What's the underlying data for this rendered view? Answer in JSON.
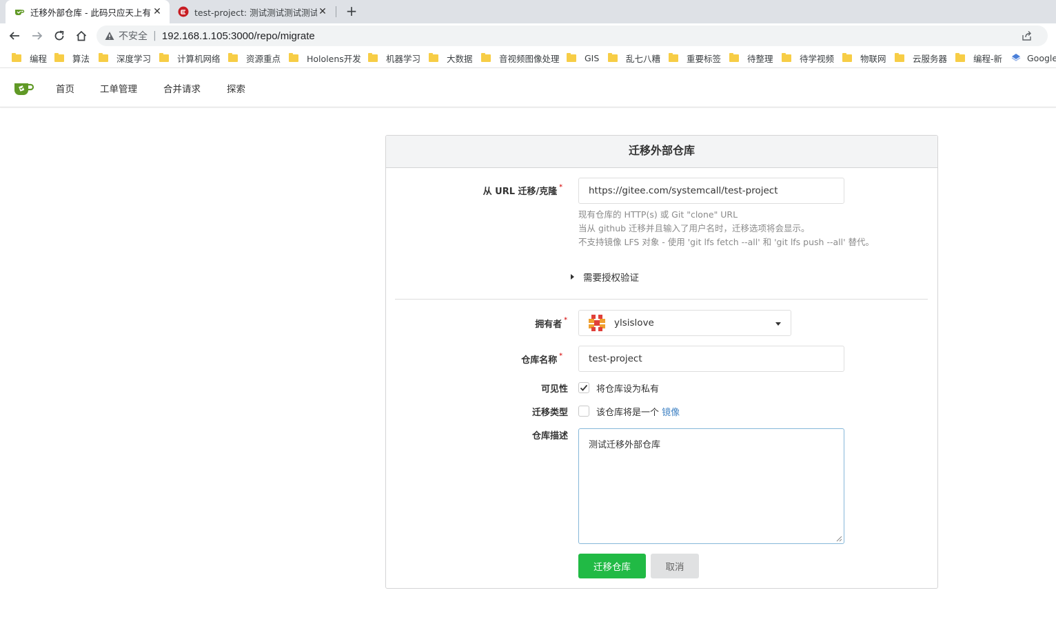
{
  "browser": {
    "tabs": [
      {
        "title": "迁移外部仓库 - 此码只应天上有",
        "active": true
      },
      {
        "title": "test-project: 测试测试测试测试",
        "active": false
      }
    ],
    "address": {
      "security_label": "不安全",
      "url": "192.168.1.105:3000/repo/migrate"
    },
    "bookmarks": [
      {
        "label": "编程",
        "icon": "folder-icon"
      },
      {
        "label": "算法",
        "icon": "folder-icon"
      },
      {
        "label": "深度学习",
        "icon": "folder-icon"
      },
      {
        "label": "计算机网络",
        "icon": "folder-icon"
      },
      {
        "label": "资源重点",
        "icon": "folder-icon"
      },
      {
        "label": "Hololens开发",
        "icon": "folder-icon"
      },
      {
        "label": "机器学习",
        "icon": "folder-icon"
      },
      {
        "label": "大数据",
        "icon": "folder-icon"
      },
      {
        "label": "音视频图像处理",
        "icon": "folder-icon"
      },
      {
        "label": "GIS",
        "icon": "folder-icon"
      },
      {
        "label": "乱七八糟",
        "icon": "folder-icon"
      },
      {
        "label": "重要标签",
        "icon": "folder-icon"
      },
      {
        "label": "待整理",
        "icon": "folder-icon"
      },
      {
        "label": "待学视频",
        "icon": "folder-icon"
      },
      {
        "label": "物联网",
        "icon": "folder-icon"
      },
      {
        "label": "云服务器",
        "icon": "folder-icon"
      },
      {
        "label": "编程-新",
        "icon": "folder-icon"
      },
      {
        "label": "Google",
        "icon": "google-icon"
      }
    ]
  },
  "nav": {
    "items": [
      "首页",
      "工单管理",
      "合并请求",
      "探索"
    ]
  },
  "form": {
    "title": "迁移外部仓库",
    "clone_url": {
      "label": "从 URL 迁移/克隆",
      "value": "https://gitee.com/systemcall/test-project"
    },
    "help_lines": [
      "现有仓库的 HTTP(s) 或 Git \"clone\" URL",
      "当从 github 迁移并且输入了用户名时，迁移选项将会显示。",
      "不支持镜像 LFS 对象 - 使用 'git lfs fetch --all' 和 'git lfs push --all' 替代。"
    ],
    "auth_toggle": "需要授权验证",
    "owner": {
      "label": "拥有者",
      "value": "ylsislove"
    },
    "repo_name": {
      "label": "仓库名称",
      "value": "test-project"
    },
    "visibility": {
      "label": "可见性",
      "checkbox_text": "将仓库设为私有",
      "checked": true
    },
    "migrate_type": {
      "label": "迁移类型",
      "checkbox_text": "该仓库将是一个",
      "link_text": "镜像",
      "checked": false
    },
    "description": {
      "label": "仓库描述",
      "value": "测试迁移外部仓库"
    },
    "submit_label": "迁移仓库",
    "cancel_label": "取消"
  },
  "colors": {
    "accent_green": "#21ba45",
    "required_red": "#db2828",
    "link_blue": "#4183c4",
    "focus_blue": "#85b7d9"
  }
}
